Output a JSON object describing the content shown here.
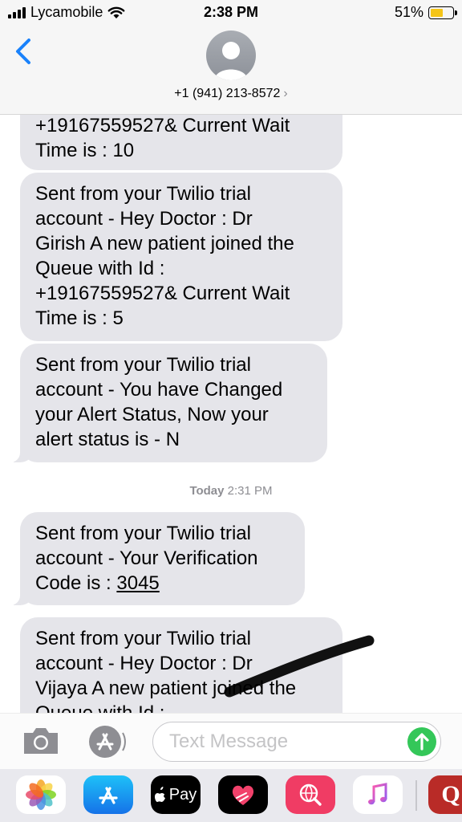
{
  "status_bar": {
    "carrier": "Lycamobile",
    "time": "2:38 PM",
    "battery": "51%"
  },
  "header": {
    "contact": "+1 (941) 213-8572",
    "chevron": "›"
  },
  "messages": [
    {
      "text": "+19167559527& Current Wait\nTime is : 10"
    },
    {
      "text": "Sent from your Twilio trial\naccount - Hey Doctor : Dr\nGirish A new patient joined the\nQueue with Id :\n+19167559527& Current Wait\nTime is : 5"
    },
    {
      "text": "Sent from your Twilio trial\naccount - You have Changed\nyour Alert Status, Now your\nalert status is - N"
    },
    {
      "text_prefix": "Sent from your Twilio trial\naccount - Your Verification\nCode is : ",
      "code": "3045"
    },
    {
      "text": "Sent from your Twilio trial\naccount - Hey Doctor : Dr\nVijaya A new patient joined the\nQueue with Id :"
    }
  ],
  "timestamp": {
    "day": "Today",
    "time": "2:31 PM"
  },
  "composer": {
    "placeholder": "Text Message"
  },
  "app_drawer": [
    {
      "name": "photos-app",
      "icon": "photos-icon"
    },
    {
      "name": "app-store-app",
      "icon": "app-store-icon"
    },
    {
      "name": "apple-pay-app",
      "icon": "apple-pay-icon",
      "label": "Pay"
    },
    {
      "name": "digital-touch-app",
      "icon": "heart-icon"
    },
    {
      "name": "image-search-app",
      "icon": "globe-search-icon"
    },
    {
      "name": "music-app",
      "icon": "music-icon"
    },
    {
      "name": "quora-app",
      "icon": "quora-icon",
      "label": "Q"
    }
  ],
  "colors": {
    "bubble": "#e5e5ea",
    "send": "#34c759",
    "accent": "#1a82fb",
    "battery": "#f5c518"
  }
}
